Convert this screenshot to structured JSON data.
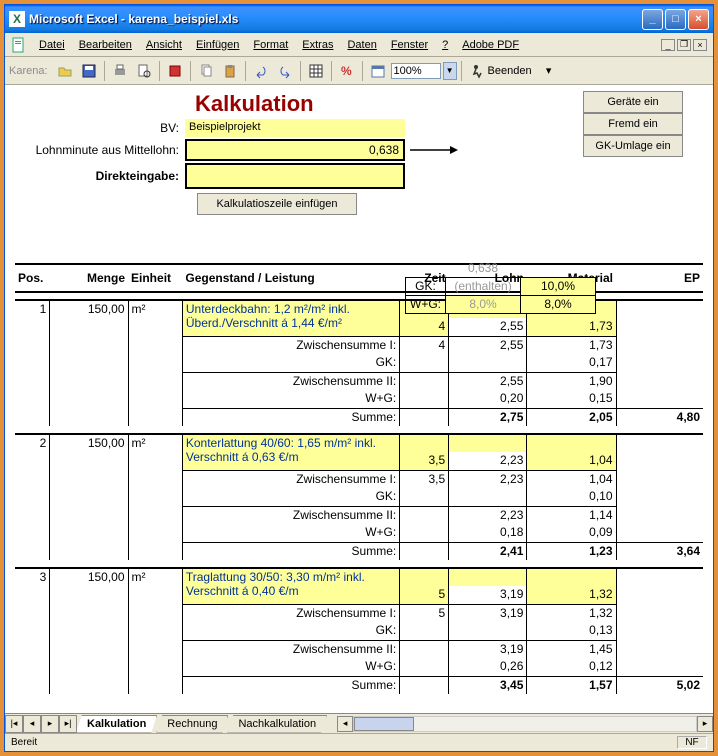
{
  "window": {
    "title": "Microsoft Excel - karena_beispiel.xls"
  },
  "menu": {
    "items": [
      "Datei",
      "Bearbeiten",
      "Ansicht",
      "Einfügen",
      "Format",
      "Extras",
      "Daten",
      "Fenster",
      "?",
      "Adobe PDF"
    ]
  },
  "toolbar": {
    "label": "Karena:",
    "zoom": "100%",
    "beenden": "Beenden"
  },
  "side_buttons": [
    "Geräte ein",
    "Fremd ein",
    "GK-Umlage ein"
  ],
  "form": {
    "title": "Kalkulation",
    "bv_label": "BV:",
    "bv_value": "Beispielprojekt",
    "lm_label": "Lohnminute aus Mittellohn:",
    "lm_value": "0,638",
    "de_label": "Direkteingabe:",
    "de_value": "",
    "insert_btn": "Kalkulatioszeile einfügen"
  },
  "pct": {
    "topnum": "0,638",
    "rows": [
      {
        "lbl": "GK:",
        "mid": "(enthalten)",
        "pct": "10,0%"
      },
      {
        "lbl": "W+G:",
        "mid": "8,0%",
        "pct": "8,0%"
      }
    ]
  },
  "headers": {
    "pos": "Pos.",
    "menge": "Menge",
    "einheit": "Einheit",
    "gegenstand": "Gegenstand / Leistung",
    "zeit": "Zeit",
    "lohn": "Lohn",
    "material": "Material",
    "ep": "EP"
  },
  "labels": {
    "zws1": "Zwischensumme I:",
    "gk": "GK:",
    "zws2": "Zwischensumme II:",
    "wg": "W+G:",
    "summe": "Summe:"
  },
  "rows": [
    {
      "pos": "1",
      "menge": "150,00",
      "einheit": "m²",
      "desc": "Unterdeckbahn: 1,2 m²/m² inkl. Überd./Verschnitt á 1,44 €/m²",
      "zeit": "4",
      "lohn": "2,55",
      "material": "1,73",
      "zws1": {
        "zeit": "4",
        "lohn": "2,55",
        "material": "1,73"
      },
      "gk": {
        "lohn": "",
        "material": "0,17"
      },
      "zws2": {
        "lohn": "2,55",
        "material": "1,90"
      },
      "wg": {
        "lohn": "0,20",
        "material": "0,15"
      },
      "summe": {
        "lohn": "2,75",
        "material": "2,05",
        "ep": "4,80"
      }
    },
    {
      "pos": "2",
      "menge": "150,00",
      "einheit": "m²",
      "desc": "Konterlattung 40/60: 1,65 m/m² inkl. Verschnitt á 0,63 €/m",
      "zeit": "3,5",
      "lohn": "2,23",
      "material": "1,04",
      "zws1": {
        "zeit": "3,5",
        "lohn": "2,23",
        "material": "1,04"
      },
      "gk": {
        "lohn": "",
        "material": "0,10"
      },
      "zws2": {
        "lohn": "2,23",
        "material": "1,14"
      },
      "wg": {
        "lohn": "0,18",
        "material": "0,09"
      },
      "summe": {
        "lohn": "2,41",
        "material": "1,23",
        "ep": "3,64"
      }
    },
    {
      "pos": "3",
      "menge": "150,00",
      "einheit": "m²",
      "desc": "Traglattung 30/50: 3,30 m/m² inkl. Verschnitt á 0,40 €/m",
      "zeit": "5",
      "lohn": "3,19",
      "material": "1,32",
      "zws1": {
        "zeit": "5",
        "lohn": "3,19",
        "material": "1,32"
      },
      "gk": {
        "lohn": "",
        "material": "0,13"
      },
      "zws2": {
        "lohn": "3,19",
        "material": "1,45"
      },
      "wg": {
        "lohn": "0,26",
        "material": "0,12"
      },
      "summe": {
        "lohn": "3,45",
        "material": "1,57",
        "ep": "5,02"
      }
    }
  ],
  "tabs": [
    "Kalkulation",
    "Rechnung",
    "Nachkalkulation"
  ],
  "status": {
    "ready": "Bereit",
    "nf": "NF"
  }
}
